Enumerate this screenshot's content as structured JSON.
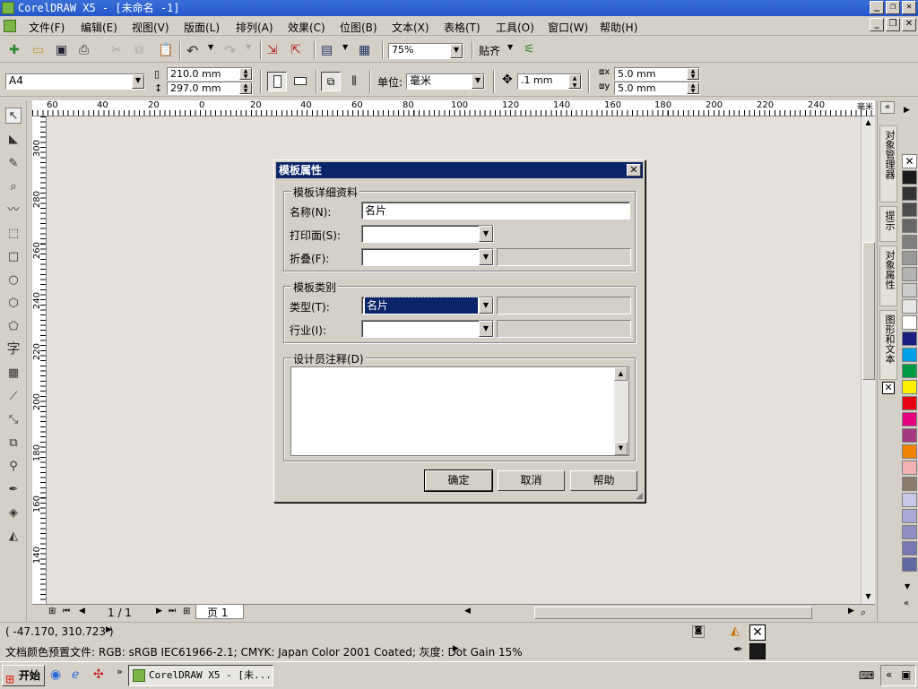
{
  "window": {
    "title": "CorelDRAW X5 - [未命名 -1]"
  },
  "menu": [
    "文件(F)",
    "编辑(E)",
    "视图(V)",
    "版面(L)",
    "排列(A)",
    "效果(C)",
    "位图(B)",
    "文本(X)",
    "表格(T)",
    "工具(O)",
    "窗口(W)",
    "帮助(H)"
  ],
  "toolbar1": {
    "zoom": "75%",
    "snap_label": "贴齐"
  },
  "toolbar2": {
    "page_size": "A4",
    "width": "210.0 mm",
    "height": "297.0 mm",
    "unit_label": "单位:",
    "unit_value": "毫米",
    "nudge": ".1 mm",
    "dup_x": "5.0 mm",
    "dup_y": "5.0 mm"
  },
  "hruler_ticks": [
    "60",
    "40",
    "20",
    "0",
    "20",
    "40",
    "60",
    "80",
    "100",
    "120",
    "140",
    "160",
    "180",
    "200",
    "220",
    "240"
  ],
  "hruler_unit": "毫米",
  "vruler_ticks": [
    "300",
    "280",
    "260",
    "240",
    "220",
    "200",
    "180",
    "160",
    "140"
  ],
  "pagebar": {
    "count": "1 / 1",
    "tab": "页 1"
  },
  "docker_tabs": [
    "对象管理器",
    "提示",
    "对象属性",
    "图形和文本"
  ],
  "palette": [
    "#1a1a1a",
    "#333333",
    "#4d4d4d",
    "#666666",
    "#808080",
    "#999999",
    "#b3b3b3",
    "#cccccc",
    "#e6e6e6",
    "#ffffff",
    "#1b1e7e",
    "#00a0e9",
    "#009944",
    "#fff100",
    "#e60012",
    "#e4007f",
    "#a4397f",
    "#f08300",
    "#f5b2b2",
    "#8c7a6b",
    "#c9c9e8",
    "#a9a9d6",
    "#8f8fc4",
    "#7878b4",
    "#5f6aa0"
  ],
  "status": {
    "coords": "( -47.170, 310.723 )",
    "profile": "文档颜色预置文件: RGB: sRGB IEC61966-2.1; CMYK: Japan Color 2001 Coated; 灰度: Dot Gain 15%"
  },
  "taskbar": {
    "start": "开始",
    "item": "CorelDRAW X5 - [未..."
  },
  "dialog": {
    "title": "模板属性",
    "group_details": "模板详细资料",
    "name_label": "名称(N):",
    "name_value": "名片",
    "print_side_label": "打印面(S):",
    "fold_label": "折叠(F):",
    "group_category": "模板类别",
    "type_label": "类型(T):",
    "type_value": "名片",
    "industry_label": "行业(I):",
    "notes_label": "设计员注释(D)",
    "ok": "确定",
    "cancel": "取消",
    "help": "帮助"
  }
}
